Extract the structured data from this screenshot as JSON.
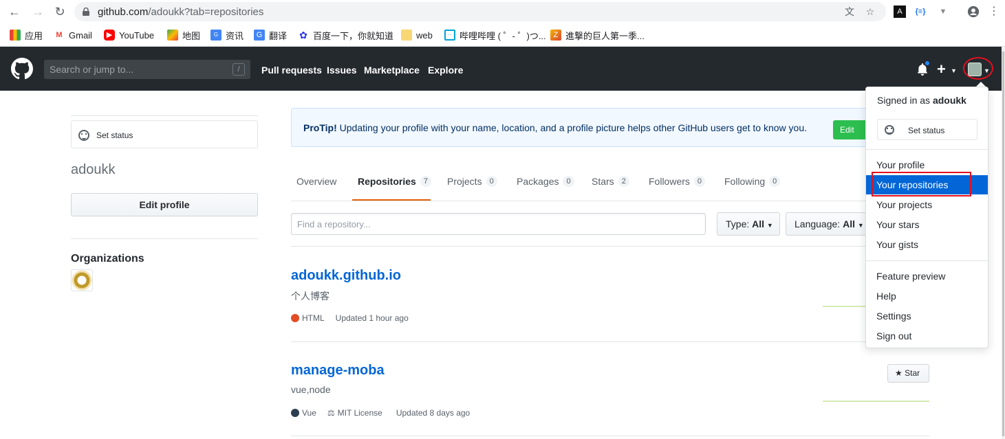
{
  "browser": {
    "url_host": "github.com",
    "url_path": "/adoukk?tab=repositories",
    "bookmarks": [
      {
        "label": "应用",
        "icon": "apps-grid-icon"
      },
      {
        "label": "Gmail",
        "icon": "gmail-icon"
      },
      {
        "label": "YouTube",
        "icon": "youtube-icon"
      },
      {
        "label": "地图",
        "icon": "maps-icon"
      },
      {
        "label": "资讯",
        "icon": "news-icon"
      },
      {
        "label": "翻译",
        "icon": "translate-icon"
      },
      {
        "label": "百度一下，你就知道",
        "icon": "baidu-icon"
      },
      {
        "label": "web",
        "icon": "folder-icon"
      },
      {
        "label": "哔哩哔哩 ( ゜- ゜)つ...",
        "icon": "bilibili-icon"
      },
      {
        "label": "進撃的巨人第一季...",
        "icon": "zhihu-icon"
      }
    ]
  },
  "header": {
    "search_placeholder": "Search or jump to...",
    "search_shortcut": "/",
    "nav": [
      "Pull requests",
      "Issues",
      "Marketplace",
      "Explore"
    ]
  },
  "profile": {
    "set_status": "Set status",
    "username": "adoukk",
    "edit_profile": "Edit profile",
    "organizations_heading": "Organizations"
  },
  "protip": {
    "strong": "ProTip!",
    "text": " Updating your profile with your name, location, and a profile picture helps other GitHub users get to know you.",
    "button": "Edit"
  },
  "tabs": [
    {
      "label": "Overview",
      "count": null
    },
    {
      "label": "Repositories",
      "count": "7",
      "selected": true
    },
    {
      "label": "Projects",
      "count": "0"
    },
    {
      "label": "Packages",
      "count": "0"
    },
    {
      "label": "Stars",
      "count": "2"
    },
    {
      "label": "Followers",
      "count": "0"
    },
    {
      "label": "Following",
      "count": "0"
    }
  ],
  "filters": {
    "search_placeholder": "Find a repository...",
    "type_label": "Type:",
    "type_value": "All",
    "language_label": "Language:",
    "language_value": "All"
  },
  "repos": [
    {
      "name": "adoukk.github.io",
      "description": "个人博客",
      "language": "HTML",
      "language_color": "#e34c26",
      "license": "",
      "updated": "Updated 1 hour ago"
    },
    {
      "name": "manage-moba",
      "description": "vue,node",
      "language": "Vue",
      "language_color": "#2c3e50",
      "license": "MIT License",
      "updated": "Updated 8 days ago",
      "star": "Star"
    }
  ],
  "dropdown": {
    "signed_in_prefix": "Signed in as ",
    "signed_in_user": "adoukk",
    "set_status": "Set status",
    "group1": [
      "Your profile",
      "Your repositories",
      "Your projects",
      "Your stars",
      "Your gists"
    ],
    "group2": [
      "Feature preview",
      "Help",
      "Settings",
      "Sign out"
    ],
    "active_item": "Your repositories"
  },
  "colors": {
    "header_bg": "#24292e",
    "link": "#0366d6",
    "tab_accent": "#e36209",
    "highlight_red": "#e3101f"
  }
}
